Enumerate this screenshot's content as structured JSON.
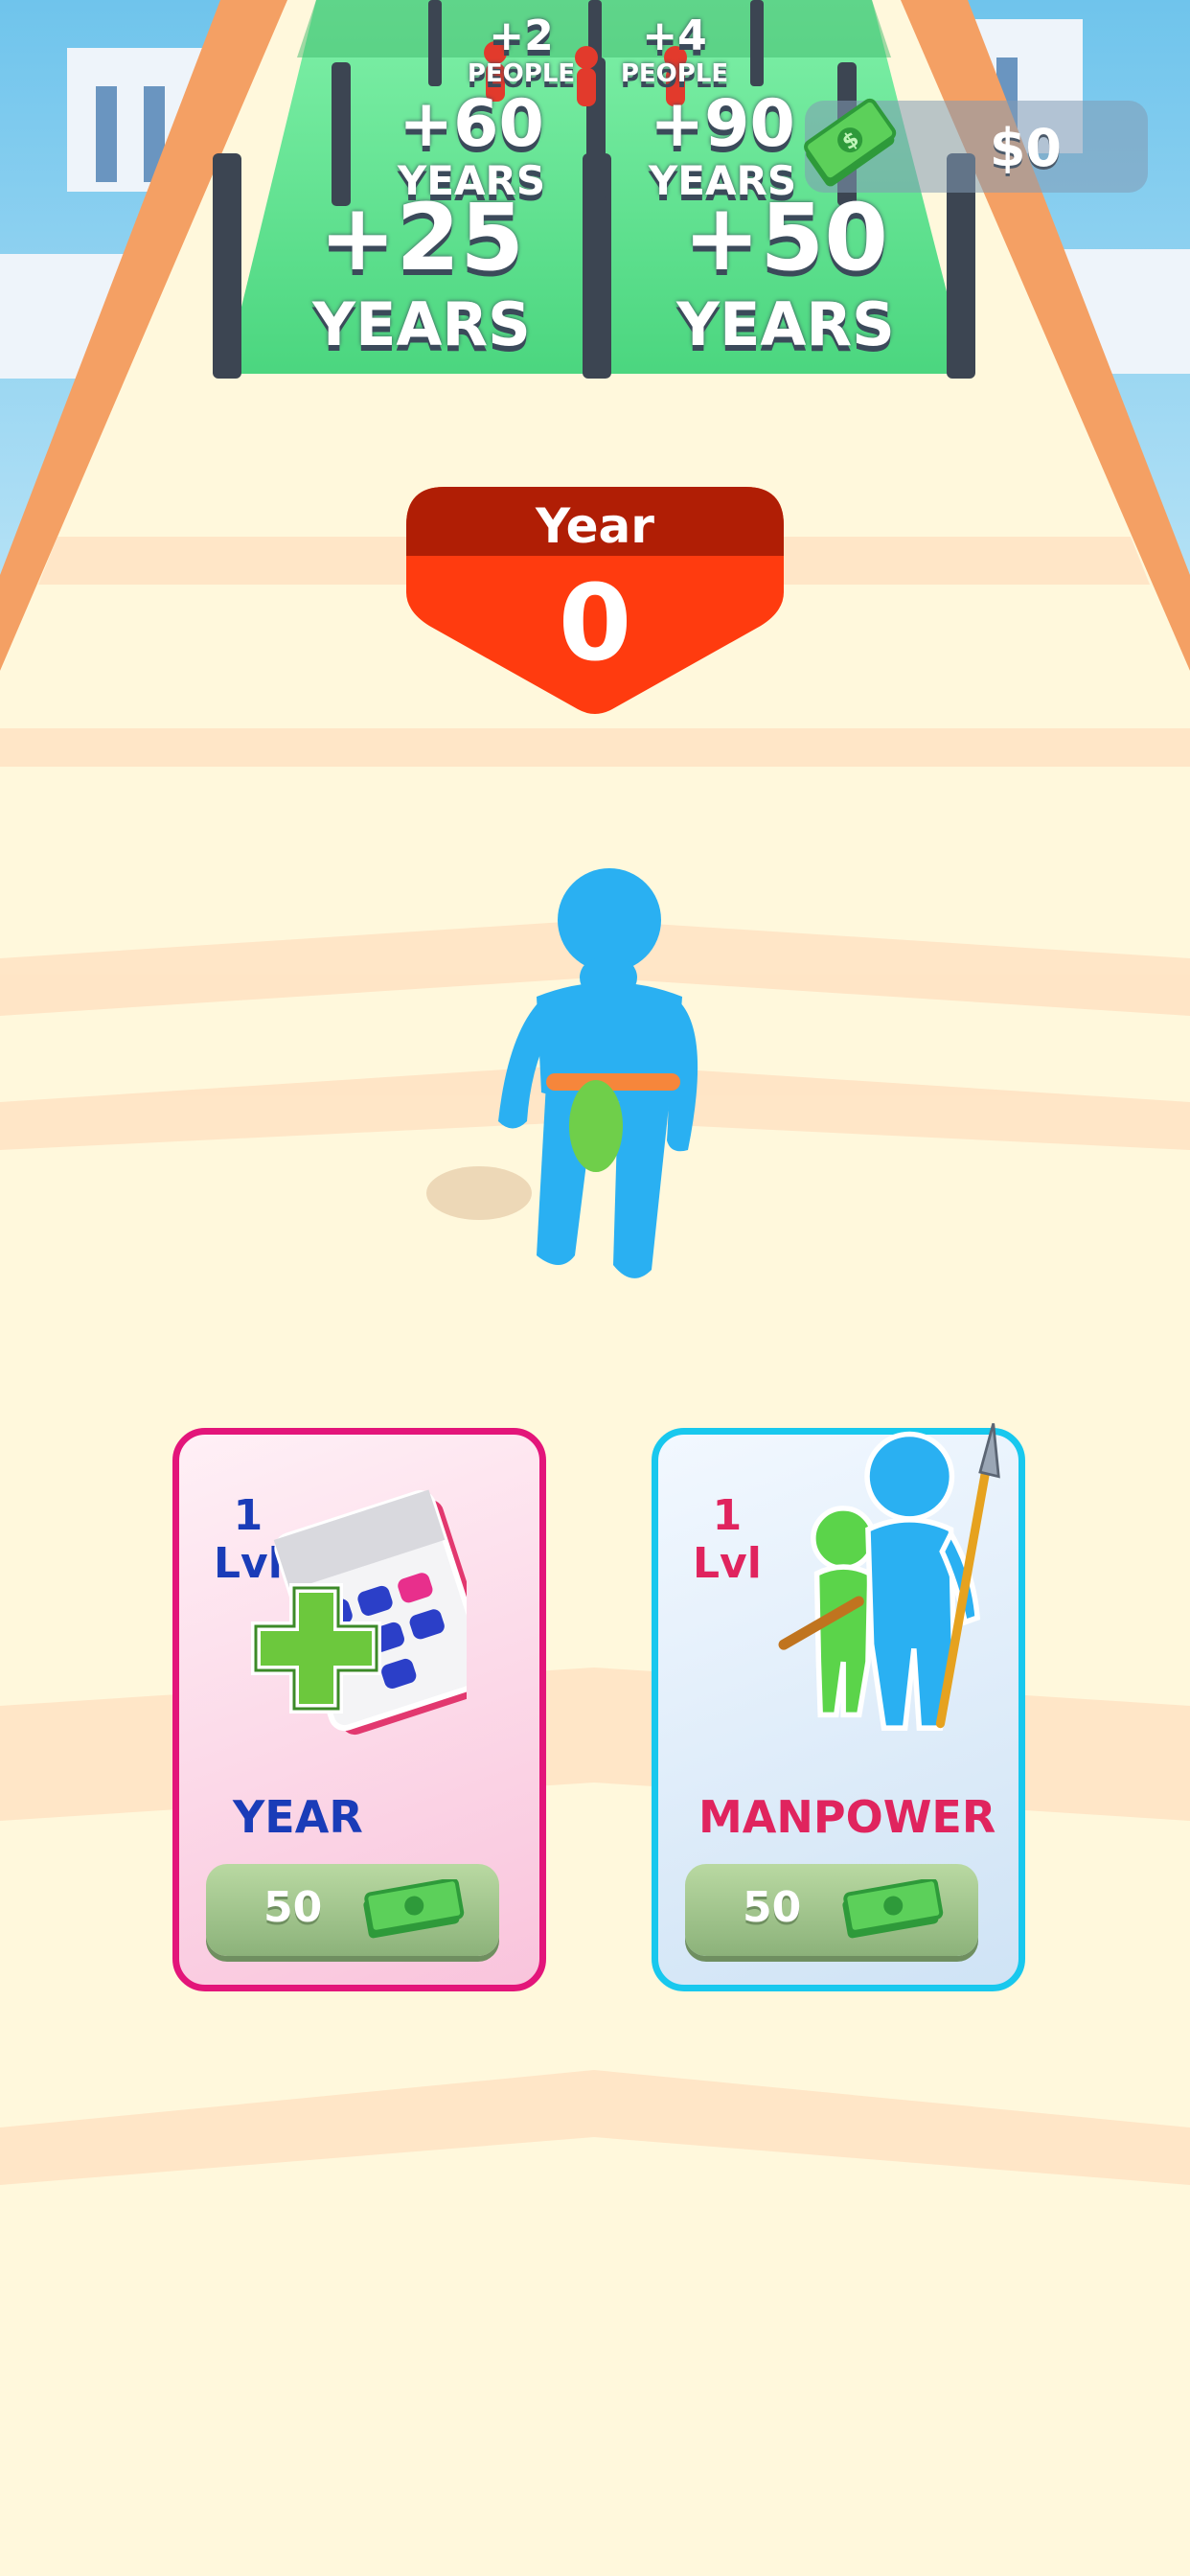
{
  "hud": {
    "money": "$0",
    "money_icon": "cash-stack-icon"
  },
  "gates": {
    "near_left": {
      "num": "+25",
      "unit": "YEARS"
    },
    "near_right": {
      "num": "+50",
      "unit": "YEARS"
    },
    "mid_left": {
      "num": "+60",
      "unit": "YEARS"
    },
    "mid_right": {
      "num": "+90",
      "unit": "YEARS"
    },
    "far_left": {
      "num": "+2",
      "unit": "PEOPLE"
    },
    "far_right": {
      "num": "+4",
      "unit": "PEOPLE"
    }
  },
  "year_badge": {
    "label": "Year",
    "value": "0"
  },
  "cards": {
    "year": {
      "level_num": "1",
      "level_suffix": "Lvl",
      "title": "YEAR",
      "price": "50",
      "icon": "calendar-plus-icon",
      "accent": "#e3157a"
    },
    "manpower": {
      "level_num": "1",
      "level_suffix": "Lvl",
      "title": "MANPOWER",
      "price": "50",
      "icon": "people-spear-icon",
      "accent": "#18c8ee"
    }
  },
  "colors": {
    "track": "#fff8dc",
    "gate_green": "#5fe08f",
    "badge_red": "#ff3b0f",
    "badge_dark_red": "#b01e05",
    "player_blue": "#2ab0f2"
  }
}
